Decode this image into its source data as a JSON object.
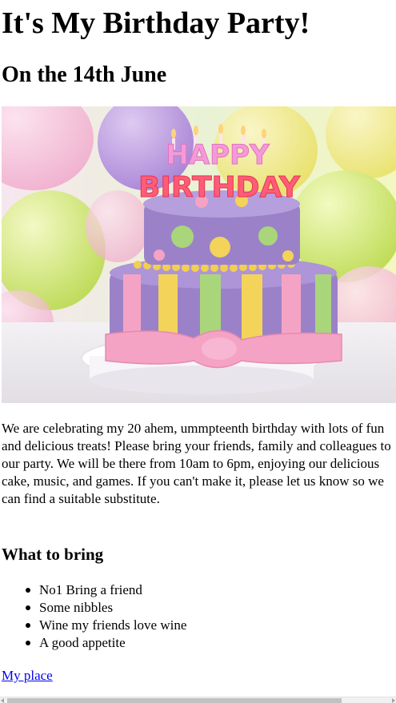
{
  "page": {
    "title": "It's My Birthday Party!",
    "subtitle": "On the 14th June",
    "intro": "We are celebrating my 20 ahem, ummpteenth birthday with lots of fun and delicious treats! Please bring your friends, family and colleagues to our party. We will be there from 10am to 6pm, enjoying our delicious cake, music, and games. If you can't make it, please let us know so we can find a suitable substitute."
  },
  "hero_image": {
    "topper_word_1": "HAPPY",
    "topper_word_2": "BIRTHDAY",
    "colors": {
      "cake_purple": "#9b82c8",
      "ribbon_pink": "#f4a3c4",
      "stripe_yellow": "#f3d35a",
      "stripe_green": "#a9d67a"
    }
  },
  "bring": {
    "heading": "What to bring",
    "items": [
      "No1 Bring a friend",
      "Some nibbles",
      "Wine my friends love wine",
      "A good appetite"
    ]
  },
  "link": {
    "label": "My place",
    "color": "#0000ee"
  }
}
